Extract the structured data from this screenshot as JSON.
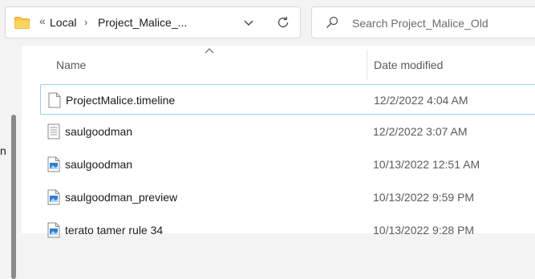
{
  "address_bar": {
    "overflow_chevron": "«",
    "crumbs": [
      "Local",
      "Project_Malice_..."
    ],
    "separator": "›"
  },
  "search": {
    "placeholder": "Search Project_Malice_Old"
  },
  "nav": {
    "partial_label": "n"
  },
  "columns": {
    "name": "Name",
    "date_modified": "Date modified"
  },
  "files": [
    {
      "name": "ProjectMalice.timeline",
      "date": "12/2/2022 4:04 AM",
      "icon": "blank-file-icon",
      "selected": true
    },
    {
      "name": "saulgoodman",
      "date": "12/2/2022 3:07 AM",
      "icon": "text-file-icon",
      "selected": false
    },
    {
      "name": "saulgoodman",
      "date": "10/13/2022 12:51 AM",
      "icon": "image-file-icon",
      "selected": false
    },
    {
      "name": "saulgoodman_preview",
      "date": "10/13/2022 9:59 PM",
      "icon": "image-file-icon",
      "selected": false
    },
    {
      "name": "terato tamer rule 34",
      "date": "10/13/2022 9:28 PM",
      "icon": "image-file-icon",
      "selected": false
    }
  ],
  "colors": {
    "accent": "#0078d4",
    "selection_border": "#98d6ee",
    "folder": "#f8c549"
  }
}
